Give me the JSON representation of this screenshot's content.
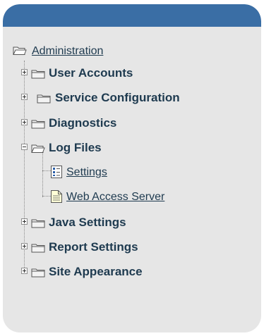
{
  "tree": {
    "root": {
      "label": "Administration",
      "icon": "open-folder-icon"
    },
    "items": [
      {
        "label": "User Accounts",
        "state": "collapsed"
      },
      {
        "label": "Service Configuration",
        "state": "collapsed"
      },
      {
        "label": "Diagnostics",
        "state": "collapsed"
      },
      {
        "label": "Log Files",
        "state": "expanded",
        "children": [
          {
            "label": "Settings",
            "icon": "settings-doc-icon"
          },
          {
            "label": "Web Access Server",
            "icon": "text-doc-icon"
          }
        ]
      },
      {
        "label": "Java Settings",
        "state": "collapsed"
      },
      {
        "label": "Report Settings",
        "state": "collapsed"
      },
      {
        "label": "Site Appearance",
        "state": "collapsed"
      }
    ]
  },
  "colors": {
    "panel_bg": "#e6e6e6",
    "header_bg": "#3a6ea5",
    "text": "#1e3a4f"
  }
}
